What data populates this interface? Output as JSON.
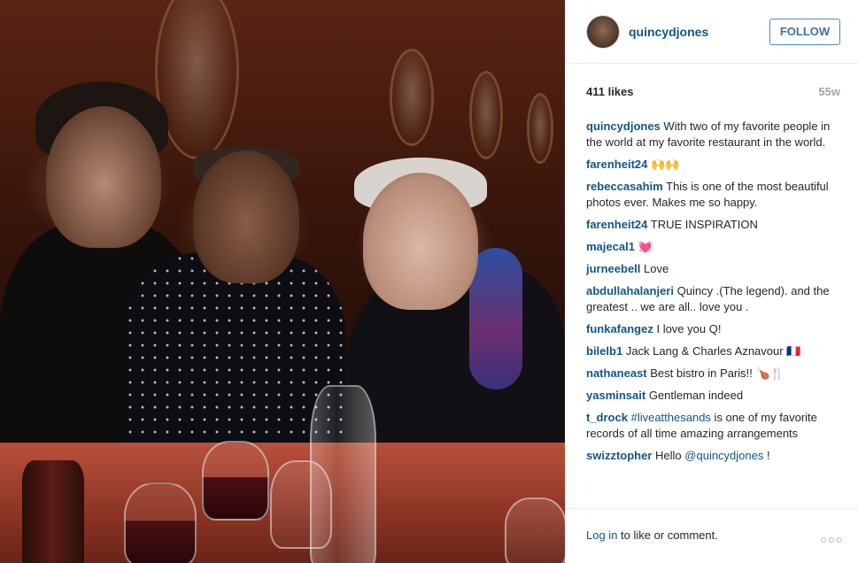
{
  "post": {
    "username": "quincydjones",
    "follow_label": "FOLLOW",
    "likes": "411 likes",
    "age": "55w"
  },
  "comments": [
    {
      "user": "quincydjones",
      "text": "With two of my favorite people in the world at my favorite restaurant in the world."
    },
    {
      "user": "farenheit24",
      "text": "🙌🙌"
    },
    {
      "user": "rebeccasahim",
      "text": "This is one of the most beautiful photos ever. Makes me so happy."
    },
    {
      "user": "farenheit24",
      "text": "TRUE INSPIRATION"
    },
    {
      "user": "majecal1",
      "text": "💓"
    },
    {
      "user": "jurneebell",
      "text": "Love"
    },
    {
      "user": "abdullahalanjeri",
      "text": "Quincy .(The legend). and the greatest .. we are all.. love you ."
    },
    {
      "user": "funkafangez",
      "text": "I love you Q!"
    },
    {
      "user": "bilelb1",
      "text": "Jack Lang & Charles Aznavour 🇫🇷"
    },
    {
      "user": "nathaneast",
      "text": "Best bistro in Paris!! 🍗🍴"
    },
    {
      "user": "yasminsait",
      "text": "Gentleman indeed"
    },
    {
      "user": "t_drock",
      "link": "#liveatthesands",
      "text": " is one of my favorite records of all time amazing arrangements"
    },
    {
      "user": "swizztopher",
      "text_before": "Hello ",
      "link": "@quincydjones",
      "text": " !"
    }
  ],
  "footer": {
    "login_link": "Log in",
    "login_text": " to like or comment.",
    "more_icon": "more-options-icon",
    "more_glyph": "○○○"
  },
  "colors": {
    "username_blue": "#125688",
    "follow_border": "#4e8ac3",
    "muted": "#a5a7aa"
  }
}
